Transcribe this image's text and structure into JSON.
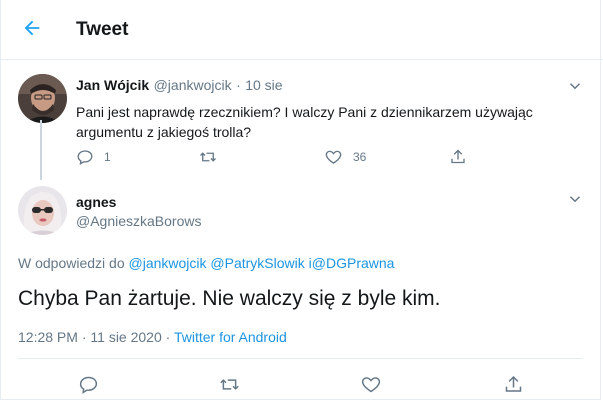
{
  "header": {
    "title": "Tweet"
  },
  "colors": {
    "accent": "#1da1f2",
    "link": "#1b95e0",
    "muted": "#657786",
    "text": "#14171a"
  },
  "parent_tweet": {
    "name": "Jan Wójcik",
    "handle": "@jankwojcik",
    "dot": "·",
    "date": "10 sie",
    "text": "Pani jest naprawdę rzecznikiem? I walczy Pani z dziennikarzem używając argumentu z jakiegoś trolla?",
    "reply_count": "1",
    "retweet_count": "",
    "like_count": "36"
  },
  "main_tweet": {
    "name": "agnes",
    "handle": "@AgnieszkaBorows",
    "reply_prefix": "W odpowiedzi do",
    "mentions": [
      "@jankwojcik",
      "@PatrykSlowik",
      "i",
      "@DGPrawna"
    ],
    "text": "Chyba Pan żartuje. Nie walczy się z byle kim.",
    "time": "12:28 PM",
    "dot": "·",
    "date": "11 sie 2020",
    "source": "Twitter for Android"
  },
  "icons": {
    "back": "arrow-left-icon",
    "more": "chevron-down-icon",
    "reply": "reply-icon",
    "retweet": "retweet-icon",
    "like": "heart-icon",
    "share": "share-icon"
  }
}
